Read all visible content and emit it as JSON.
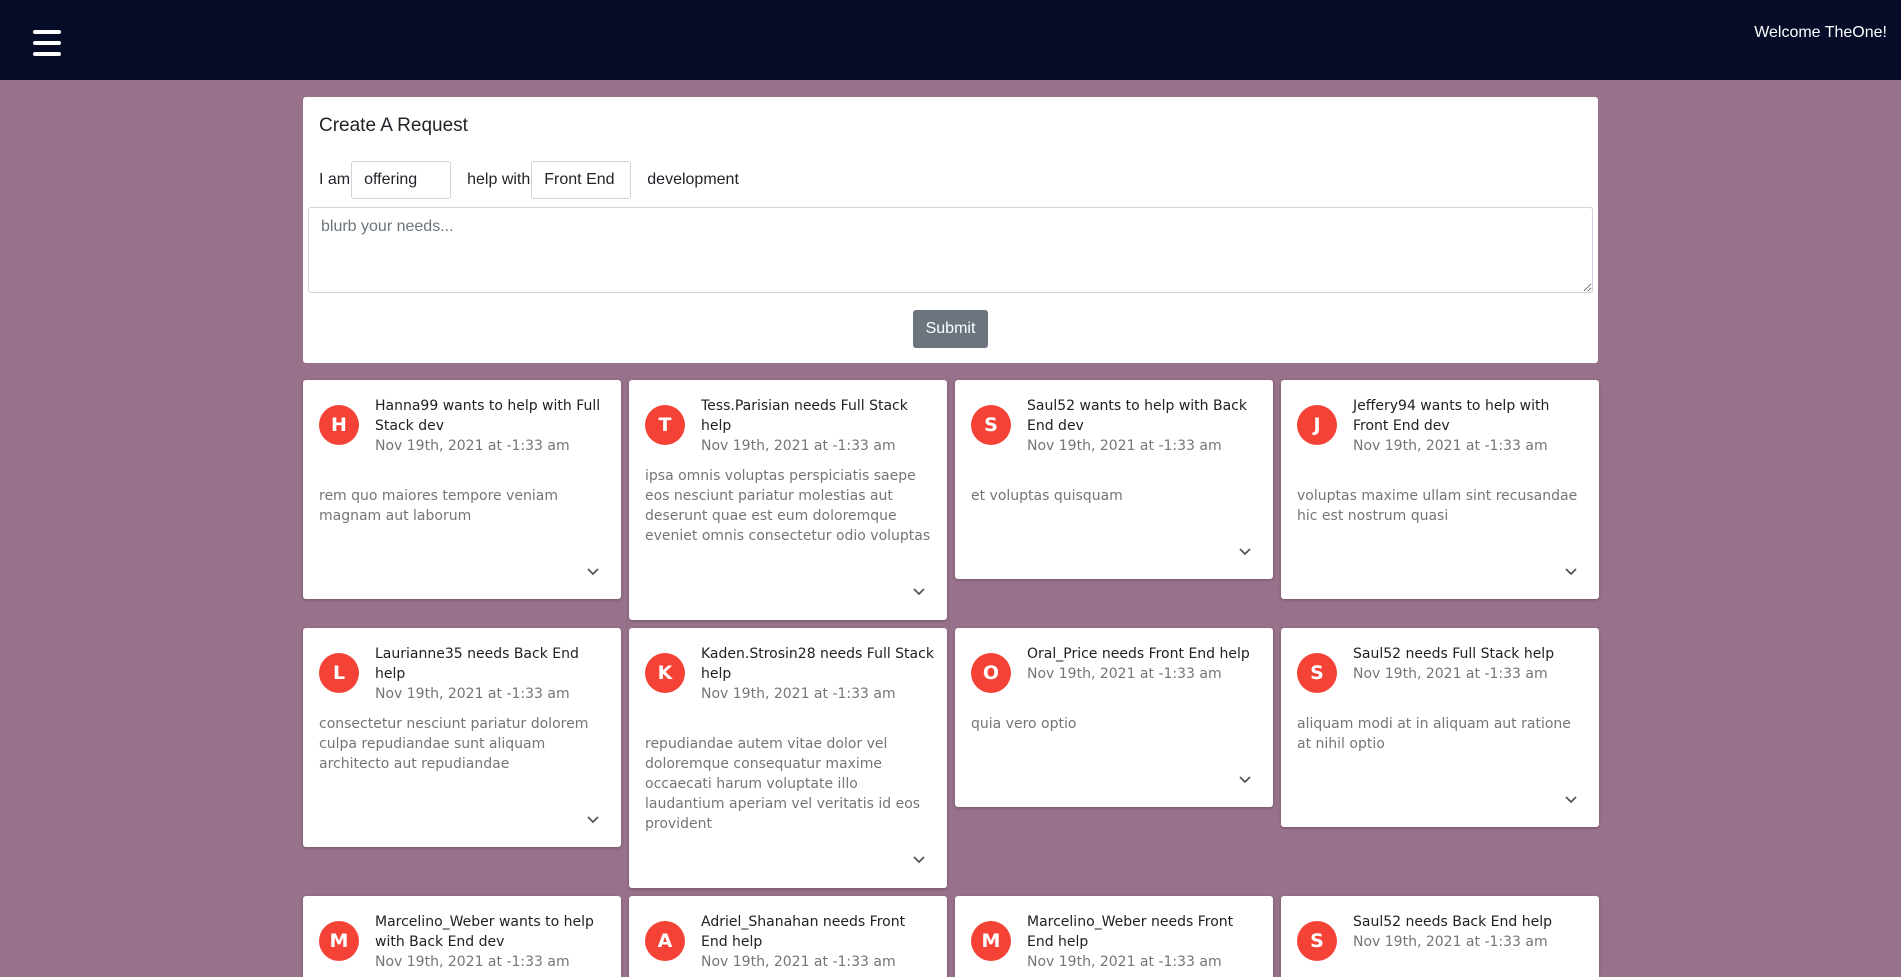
{
  "header": {
    "welcome": "Welcome TheOne!"
  },
  "create_request": {
    "title": "Create A Request",
    "i_am": "I am",
    "mode_value": "offering",
    "help_with": "help with",
    "area_value": "Front End",
    "development": "development",
    "blurb_placeholder": "blurb your needs...",
    "submit_label": "Submit"
  },
  "requests": [
    {
      "initial": "H",
      "title": "Hanna99 wants to help with Full Stack dev",
      "date": "Nov 19th, 2021 at -1:33 am",
      "body": "rem quo maiores tempore veniam magnam aut laborum"
    },
    {
      "initial": "T",
      "title": "Tess.Parisian needs Full Stack help",
      "date": "Nov 19th, 2021 at -1:33 am",
      "body": "ipsa omnis voluptas perspiciatis saepe eos nesciunt pariatur molestias aut deserunt quae est eum doloremque eveniet omnis consectetur odio voluptas"
    },
    {
      "initial": "S",
      "title": "Saul52 wants to help with Back End dev",
      "date": "Nov 19th, 2021 at -1:33 am",
      "body": "et voluptas quisquam"
    },
    {
      "initial": "J",
      "title": "Jeffery94 wants to help with Front End dev",
      "date": "Nov 19th, 2021 at -1:33 am",
      "body": "voluptas maxime ullam sint recusandae hic est nostrum quasi"
    },
    {
      "initial": "L",
      "title": "Laurianne35 needs Back End help",
      "date": "Nov 19th, 2021 at -1:33 am",
      "body": "consectetur nesciunt pariatur dolorem culpa repudiandae sunt aliquam architecto aut repudiandae"
    },
    {
      "initial": "K",
      "title": "Kaden.Strosin28 needs Full Stack help",
      "date": "Nov 19th, 2021 at -1:33 am",
      "body": "repudiandae autem vitae dolor vel doloremque consequatur maxime occaecati harum voluptate illo laudantium aperiam vel veritatis id eos provident"
    },
    {
      "initial": "O",
      "title": "Oral_Price needs Front End help",
      "date": "Nov 19th, 2021 at -1:33 am",
      "body": "quia vero optio"
    },
    {
      "initial": "S",
      "title": "Saul52 needs Full Stack help",
      "date": "Nov 19th, 2021 at -1:33 am",
      "body": "aliquam modi at in aliquam aut ratione at nihil optio"
    },
    {
      "initial": "M",
      "title": "Marcelino_Weber wants to help with Back End dev",
      "date": "Nov 19th, 2021 at -1:33 am",
      "body": ""
    },
    {
      "initial": "A",
      "title": "Adriel_Shanahan needs Front End help",
      "date": "Nov 19th, 2021 at -1:33 am",
      "body": ""
    },
    {
      "initial": "M",
      "title": "Marcelino_Weber needs Front End help",
      "date": "Nov 19th, 2021 at -1:33 am",
      "body": ""
    },
    {
      "initial": "S",
      "title": "Saul52 needs Back End help",
      "date": "Nov 19th, 2021 at -1:33 am",
      "body": ""
    }
  ]
}
